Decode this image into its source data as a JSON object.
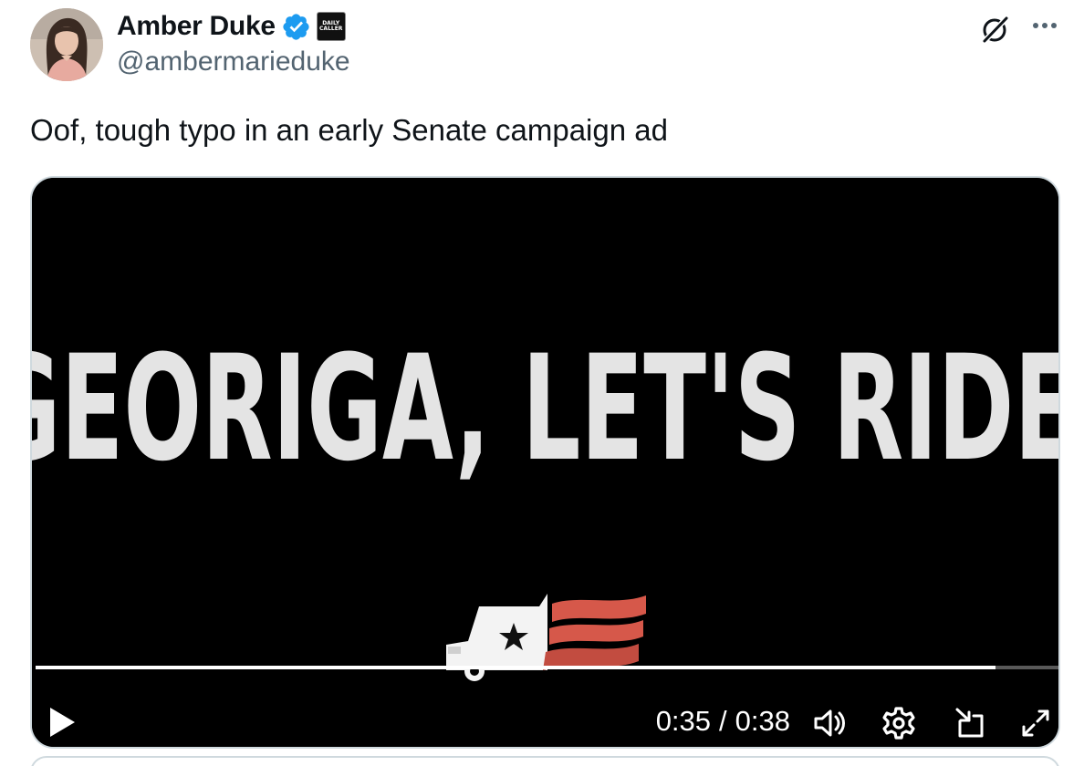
{
  "author": {
    "display_name": "Amber Duke",
    "handle": "@ambermarieduke",
    "verified_badge_color": "#1d9bf0",
    "affiliate_badge": {
      "line1": "DAILY",
      "line2": "CALLER"
    },
    "avatar_icon": "profile-photo"
  },
  "header_actions": {
    "grok_icon": "grok-icon",
    "more_icon": "more-icon"
  },
  "tweet": {
    "text": "Oof, tough typo in an early Senate campaign ad"
  },
  "video": {
    "frame_text": "GEORIGA, LET'S RIDE",
    "frame_logo_icon": "truck-flag-logo",
    "progress": 0.937,
    "current_time": "0:35",
    "separator": "/",
    "duration": "0:38",
    "controls": {
      "play_icon": "play-icon",
      "volume_icon": "volume-icon",
      "settings_icon": "settings-icon",
      "dock_icon": "dock-icon",
      "fullscreen_icon": "fullscreen-icon"
    }
  },
  "colors": {
    "text_primary": "#0f1419",
    "text_secondary": "#536471",
    "border": "#cfd9de",
    "flag_red": "#d6584a"
  }
}
